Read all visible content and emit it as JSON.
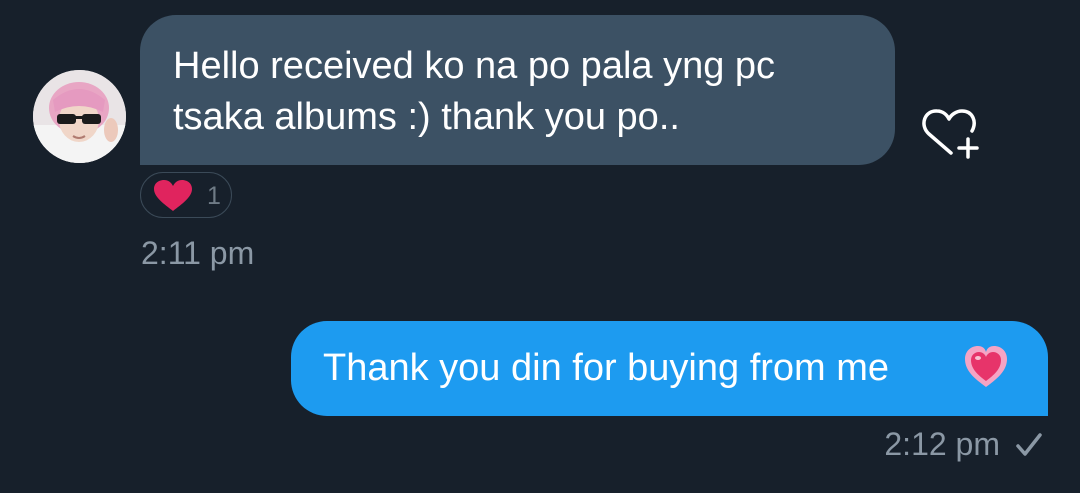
{
  "incoming": {
    "lines": [
      "Hello received ko na po pala yng pc",
      "tsaka albums :) thank you po.."
    ],
    "avatar_icon": "avatar-photo",
    "reaction": {
      "icon": "red-heart-icon",
      "count": "1"
    },
    "time": "2:11 pm",
    "react_button_icon": "heart-plus-icon"
  },
  "outgoing": {
    "text": "Thank you din for buying from me",
    "emoji_icon": "pink-heart-emoji",
    "time": "2:12 pm",
    "status_icon": "check-icon"
  },
  "colors": {
    "background": "#17202b",
    "incoming_bubble": "#3c5164",
    "outgoing_bubble": "#1d9bf0",
    "timestamp": "#8b98a5",
    "reaction_heart": "#e0245e"
  }
}
